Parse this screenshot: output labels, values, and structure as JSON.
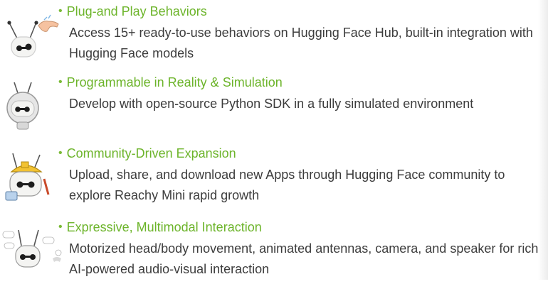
{
  "features": [
    {
      "title": "Plug-and Play Behaviors",
      "description": "Access 15+ ready-to-use behaviors on Hugging Face Hub, built-in integration with Hugging Face models",
      "icon": "robot-hand-icon"
    },
    {
      "title": "Programmable in Reality & Simulation",
      "description": "Develop with open-source Python SDK in a fully simulated environment",
      "icon": "robot-astronaut-icon"
    },
    {
      "title": "Community-Driven Expansion",
      "description": "Upload, share, and download new Apps through Hugging Face community to explore Reachy Mini rapid growth",
      "icon": "robot-builder-icon"
    },
    {
      "title": "Expressive, Multimodal Interaction",
      "description": "Motorized head/body movement, animated antennas, camera, and speaker for rich AI-powered audio-visual interaction",
      "icon": "robot-speech-icon"
    }
  ],
  "colors": {
    "accent": "#6cb42a",
    "text": "#3c3c3c",
    "background": "#ffffff"
  }
}
